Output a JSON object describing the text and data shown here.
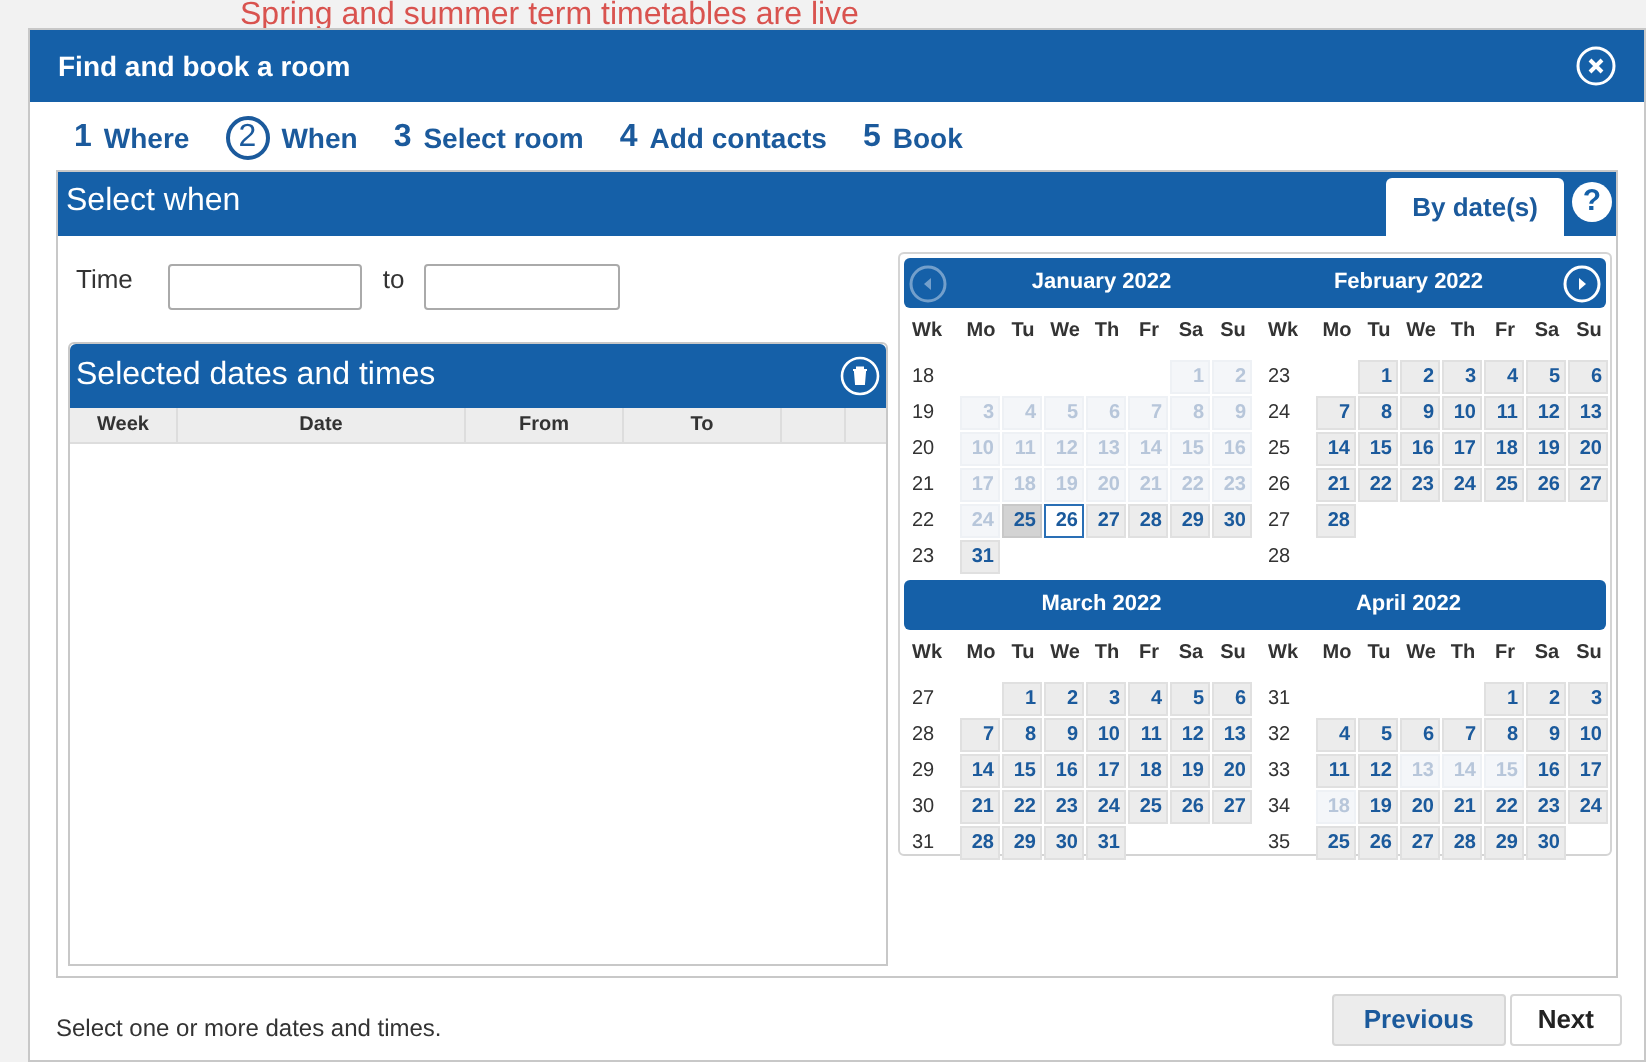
{
  "background": {
    "notice": "Spring and summer term timetables are live"
  },
  "dialog": {
    "title": "Find and book a room"
  },
  "steps": [
    {
      "number": "1",
      "label": "Where",
      "selected": false
    },
    {
      "number": "2",
      "label": "When",
      "selected": true
    },
    {
      "number": "3",
      "label": "Select room",
      "selected": false
    },
    {
      "number": "4",
      "label": "Add contacts",
      "selected": false
    },
    {
      "number": "5",
      "label": "Book",
      "selected": false
    }
  ],
  "panel": {
    "title": "Select when",
    "tabs": [
      {
        "label": "By date(s)",
        "selected": true
      }
    ],
    "help": "?"
  },
  "time": {
    "label": "Time",
    "separator": "to"
  },
  "selected_table": {
    "title": "Selected dates and times",
    "columns": [
      "Week",
      "Date",
      "From",
      "To"
    ]
  },
  "calendar": {
    "prev_disabled": true,
    "next_disabled": false,
    "rows": [
      {
        "months": [
          {
            "title": "January 2022",
            "header": [
              "Wk",
              "Mo",
              "Tu",
              "We",
              "Th",
              "Fr",
              "Sa",
              "Su"
            ],
            "weeks": [
              {
                "week": "18",
                "partial_start": true,
                "days": [
                  {
                    "label": "1",
                    "kind": "past"
                  },
                  {
                    "label": "2",
                    "kind": "past"
                  }
                ]
              },
              {
                "week": "19",
                "days": [
                  {
                    "label": "3",
                    "kind": "past"
                  },
                  {
                    "label": "4",
                    "kind": "past"
                  },
                  {
                    "label": "5",
                    "kind": "past"
                  },
                  {
                    "label": "6",
                    "kind": "past"
                  },
                  {
                    "label": "7",
                    "kind": "past"
                  },
                  {
                    "label": "8",
                    "kind": "past"
                  },
                  {
                    "label": "9",
                    "kind": "past"
                  }
                ]
              },
              {
                "week": "20",
                "days": [
                  {
                    "label": "10",
                    "kind": "past"
                  },
                  {
                    "label": "11",
                    "kind": "past"
                  },
                  {
                    "label": "12",
                    "kind": "past"
                  },
                  {
                    "label": "13",
                    "kind": "past"
                  },
                  {
                    "label": "14",
                    "kind": "past"
                  },
                  {
                    "label": "15",
                    "kind": "past"
                  },
                  {
                    "label": "16",
                    "kind": "past"
                  }
                ]
              },
              {
                "week": "21",
                "days": [
                  {
                    "label": "17",
                    "kind": "past"
                  },
                  {
                    "label": "18",
                    "kind": "past"
                  },
                  {
                    "label": "19",
                    "kind": "past"
                  },
                  {
                    "label": "20",
                    "kind": "past"
                  },
                  {
                    "label": "21",
                    "kind": "past"
                  },
                  {
                    "label": "22",
                    "kind": "past"
                  },
                  {
                    "label": "23",
                    "kind": "past"
                  }
                ]
              },
              {
                "week": "22",
                "days": [
                  {
                    "label": "24",
                    "kind": "past"
                  },
                  {
                    "label": "25",
                    "kind": "hover"
                  },
                  {
                    "label": "26",
                    "kind": "today"
                  },
                  {
                    "label": "27",
                    "kind": "open"
                  },
                  {
                    "label": "28",
                    "kind": "open"
                  },
                  {
                    "label": "29",
                    "kind": "open"
                  },
                  {
                    "label": "30",
                    "kind": "open"
                  }
                ]
              },
              {
                "week": "23",
                "days": [
                  {
                    "label": "31",
                    "kind": "open"
                  }
                ]
              }
            ]
          },
          {
            "title": "February 2022",
            "header": [
              "Wk",
              "Mo",
              "Tu",
              "We",
              "Th",
              "Fr",
              "Sa",
              "Su"
            ],
            "weeks": [
              {
                "week": "23",
                "partial_start": true,
                "days": [
                  {
                    "label": "1",
                    "kind": "open"
                  },
                  {
                    "label": "2",
                    "kind": "open"
                  },
                  {
                    "label": "3",
                    "kind": "open"
                  },
                  {
                    "label": "4",
                    "kind": "open"
                  },
                  {
                    "label": "5",
                    "kind": "open"
                  },
                  {
                    "label": "6",
                    "kind": "open"
                  }
                ]
              },
              {
                "week": "24",
                "days": [
                  {
                    "label": "7",
                    "kind": "open"
                  },
                  {
                    "label": "8",
                    "kind": "open"
                  },
                  {
                    "label": "9",
                    "kind": "open"
                  },
                  {
                    "label": "10",
                    "kind": "open"
                  },
                  {
                    "label": "11",
                    "kind": "open"
                  },
                  {
                    "label": "12",
                    "kind": "open"
                  },
                  {
                    "label": "13",
                    "kind": "open"
                  }
                ]
              },
              {
                "week": "25",
                "days": [
                  {
                    "label": "14",
                    "kind": "open"
                  },
                  {
                    "label": "15",
                    "kind": "open"
                  },
                  {
                    "label": "16",
                    "kind": "open"
                  },
                  {
                    "label": "17",
                    "kind": "open"
                  },
                  {
                    "label": "18",
                    "kind": "open"
                  },
                  {
                    "label": "19",
                    "kind": "open"
                  },
                  {
                    "label": "20",
                    "kind": "open"
                  }
                ]
              },
              {
                "week": "26",
                "days": [
                  {
                    "label": "21",
                    "kind": "open"
                  },
                  {
                    "label": "22",
                    "kind": "open"
                  },
                  {
                    "label": "23",
                    "kind": "open"
                  },
                  {
                    "label": "24",
                    "kind": "open"
                  },
                  {
                    "label": "25",
                    "kind": "open"
                  },
                  {
                    "label": "26",
                    "kind": "open"
                  },
                  {
                    "label": "27",
                    "kind": "open"
                  }
                ]
              },
              {
                "week": "27",
                "days": [
                  {
                    "label": "28",
                    "kind": "open"
                  }
                ]
              },
              {
                "week": "28"
              }
            ]
          }
        ]
      },
      {
        "months": [
          {
            "title": "March 2022",
            "header": [
              "Wk",
              "Mo",
              "Tu",
              "We",
              "Th",
              "Fr",
              "Sa",
              "Su"
            ],
            "weeks": [
              {
                "week": "27",
                "partial_start": true,
                "days": [
                  {
                    "label": "1",
                    "kind": "open"
                  },
                  {
                    "label": "2",
                    "kind": "open"
                  },
                  {
                    "label": "3",
                    "kind": "open"
                  },
                  {
                    "label": "4",
                    "kind": "open"
                  },
                  {
                    "label": "5",
                    "kind": "open"
                  },
                  {
                    "label": "6",
                    "kind": "open"
                  }
                ]
              },
              {
                "week": "28",
                "days": [
                  {
                    "label": "7",
                    "kind": "open"
                  },
                  {
                    "label": "8",
                    "kind": "open"
                  },
                  {
                    "label": "9",
                    "kind": "open"
                  },
                  {
                    "label": "10",
                    "kind": "open"
                  },
                  {
                    "label": "11",
                    "kind": "open"
                  },
                  {
                    "label": "12",
                    "kind": "open"
                  },
                  {
                    "label": "13",
                    "kind": "open"
                  }
                ]
              },
              {
                "week": "29",
                "days": [
                  {
                    "label": "14",
                    "kind": "open"
                  },
                  {
                    "label": "15",
                    "kind": "open"
                  },
                  {
                    "label": "16",
                    "kind": "open"
                  },
                  {
                    "label": "17",
                    "kind": "open"
                  },
                  {
                    "label": "18",
                    "kind": "open"
                  },
                  {
                    "label": "19",
                    "kind": "open"
                  },
                  {
                    "label": "20",
                    "kind": "open"
                  }
                ]
              },
              {
                "week": "30",
                "days": [
                  {
                    "label": "21",
                    "kind": "open"
                  },
                  {
                    "label": "22",
                    "kind": "open"
                  },
                  {
                    "label": "23",
                    "kind": "open"
                  },
                  {
                    "label": "24",
                    "kind": "open"
                  },
                  {
                    "label": "25",
                    "kind": "open"
                  },
                  {
                    "label": "26",
                    "kind": "open"
                  },
                  {
                    "label": "27",
                    "kind": "open"
                  }
                ]
              },
              {
                "week": "31",
                "days": [
                  {
                    "label": "28",
                    "kind": "open"
                  },
                  {
                    "label": "29",
                    "kind": "open"
                  },
                  {
                    "label": "30",
                    "kind": "open"
                  },
                  {
                    "label": "31",
                    "kind": "open"
                  }
                ]
              }
            ]
          },
          {
            "title": "April 2022",
            "header": [
              "Wk",
              "Mo",
              "Tu",
              "We",
              "Th",
              "Fr",
              "Sa",
              "Su"
            ],
            "weeks": [
              {
                "week": "31",
                "partial_start": true,
                "days": [
                  {
                    "label": "1",
                    "kind": "open"
                  },
                  {
                    "label": "2",
                    "kind": "open"
                  },
                  {
                    "label": "3",
                    "kind": "open"
                  }
                ]
              },
              {
                "week": "32",
                "days": [
                  {
                    "label": "4",
                    "kind": "open"
                  },
                  {
                    "label": "5",
                    "kind": "open"
                  },
                  {
                    "label": "6",
                    "kind": "open"
                  },
                  {
                    "label": "7",
                    "kind": "open"
                  },
                  {
                    "label": "8",
                    "kind": "open"
                  },
                  {
                    "label": "9",
                    "kind": "open"
                  },
                  {
                    "label": "10",
                    "kind": "open"
                  }
                ]
              },
              {
                "week": "33",
                "days": [
                  {
                    "label": "11",
                    "kind": "open"
                  },
                  {
                    "label": "12",
                    "kind": "open"
                  },
                  {
                    "label": "13",
                    "kind": "past"
                  },
                  {
                    "label": "14",
                    "kind": "past"
                  },
                  {
                    "label": "15",
                    "kind": "past"
                  },
                  {
                    "label": "16",
                    "kind": "open"
                  },
                  {
                    "label": "17",
                    "kind": "open"
                  }
                ]
              },
              {
                "week": "34",
                "days": [
                  {
                    "label": "18",
                    "kind": "past"
                  },
                  {
                    "label": "19",
                    "kind": "open"
                  },
                  {
                    "label": "20",
                    "kind": "open"
                  },
                  {
                    "label": "21",
                    "kind": "open"
                  },
                  {
                    "label": "22",
                    "kind": "open"
                  },
                  {
                    "label": "23",
                    "kind": "open"
                  },
                  {
                    "label": "24",
                    "kind": "open"
                  }
                ]
              },
              {
                "week": "35",
                "days": [
                  {
                    "label": "25",
                    "kind": "open"
                  },
                  {
                    "label": "26",
                    "kind": "open"
                  },
                  {
                    "label": "27",
                    "kind": "open"
                  },
                  {
                    "label": "28",
                    "kind": "open"
                  },
                  {
                    "label": "29",
                    "kind": "open"
                  },
                  {
                    "label": "30",
                    "kind": "open"
                  }
                ]
              }
            ]
          }
        ]
      }
    ]
  },
  "footer": {
    "hint": "Select one or more dates and times.",
    "buttons": [
      {
        "label": "Previous",
        "kind": "secondary"
      },
      {
        "label": "Next",
        "kind": "primary"
      }
    ]
  }
}
